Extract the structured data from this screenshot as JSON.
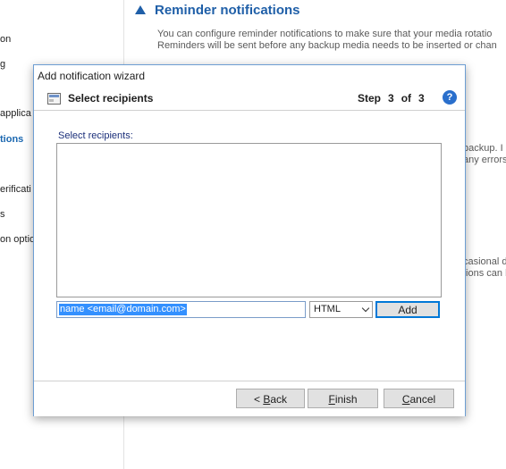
{
  "background": {
    "section_title": "Reminder notifications",
    "description_lines": [
      "You can configure reminder notifications to make sure that your media rotatio",
      "Reminders will be sent before any backup media needs to be inserted or chan"
    ],
    "left_nav": [
      "on",
      "g",
      "applica",
      "tions",
      "erificati",
      "s",
      "on optio"
    ],
    "right_fragments": [
      "backup. I",
      "any errors",
      "casional d",
      "tions can b"
    ]
  },
  "dialog": {
    "title": "Add notification wizard",
    "header": {
      "title": "Select recipients",
      "step_word": "Step",
      "step_current": "3",
      "step_of": "of",
      "step_total": "3",
      "help_glyph": "?"
    },
    "recipients_label": "Select recipients:",
    "email_value": "name <email@domain.com>",
    "format_value": "HTML",
    "add_label": "Add",
    "buttons": {
      "back_prefix": "< ",
      "back_underlined": "B",
      "back_rest": "ack",
      "finish_underlined": "F",
      "finish_rest": "inish",
      "cancel_underlined": "C",
      "cancel_rest": "ancel"
    }
  },
  "colors": {
    "accent": "#1f5fa8",
    "selection": "#3390ff",
    "help": "#2a6fcc",
    "dialog_border": "#6d9ed3"
  }
}
